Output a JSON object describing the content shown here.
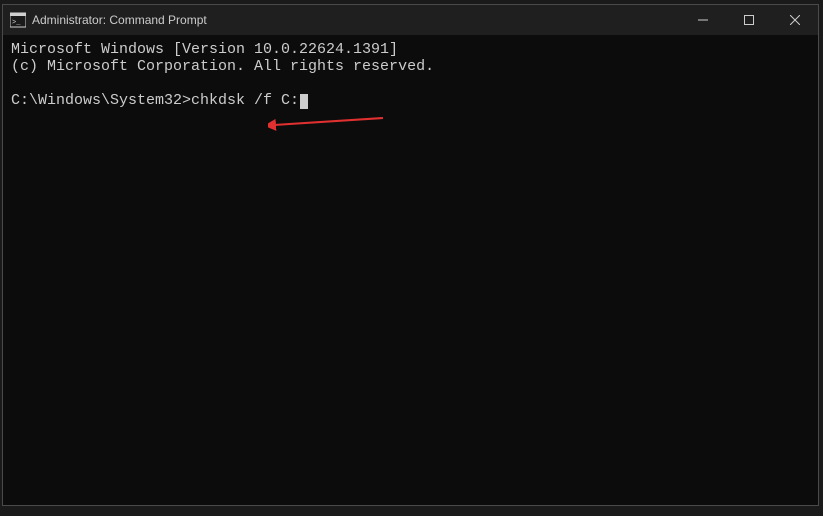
{
  "window": {
    "title": "Administrator: Command Prompt"
  },
  "terminal": {
    "line1": "Microsoft Windows [Version 10.0.22624.1391]",
    "line2": "(c) Microsoft Corporation. All rights reserved.",
    "prompt": "C:\\Windows\\System32>",
    "command": "chkdsk /f C:"
  }
}
